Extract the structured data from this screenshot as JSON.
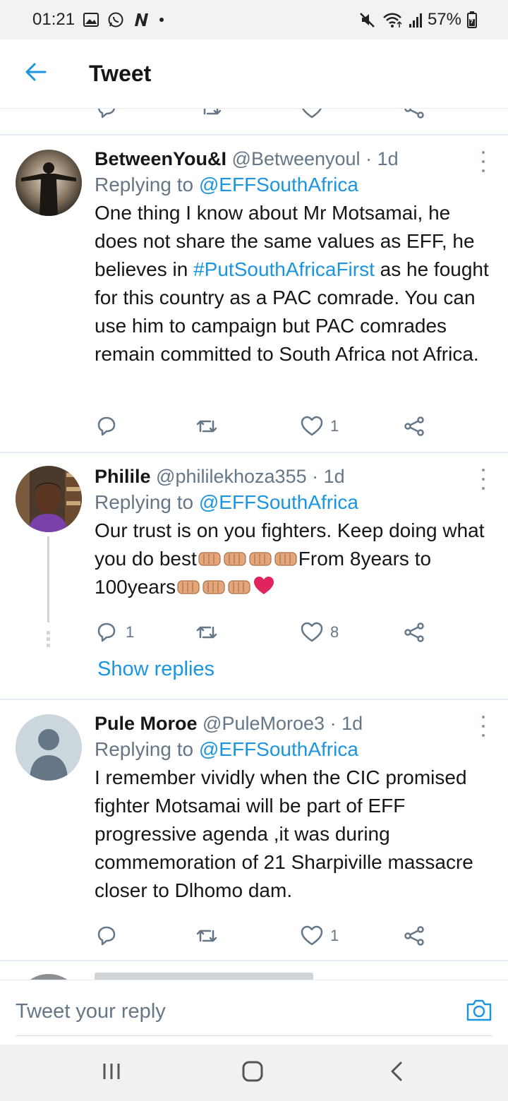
{
  "status_bar": {
    "time": "01:21",
    "battery": "57%",
    "icons_left": [
      "gallery-icon",
      "whatsapp-icon",
      "n-app-icon",
      "dot-icon"
    ],
    "icons_right": [
      "mute-icon",
      "wifi-icon",
      "signal-icon",
      "battery-icon"
    ]
  },
  "header": {
    "title": "Tweet",
    "back_icon": "arrow-left-icon"
  },
  "colors": {
    "accent": "#1b95e0",
    "secondary_text": "#657786",
    "heart": "#e0245e"
  },
  "tweets": [
    {
      "name": "BetweenYou&I",
      "handle": "@Betweenyoul",
      "sep": "·",
      "time": "1d",
      "replying_prefix": "Replying to",
      "replying_to": "@EFFSouthAfrica",
      "text_1": "One thing I know about Mr Motsamai, he does not share the same values as EFF, he believes in",
      "hashtag": "#PutSouthAfricaFirst",
      "text_2": "as he fought for this country as a PAC comrade. You can use him to campaign but PAC comrades remain committed to South Africa not Africa.",
      "reply_count": "",
      "like_count": "1"
    },
    {
      "name": "Philile",
      "handle": "@phililekhoza355",
      "sep": "·",
      "time": "1d",
      "replying_prefix": "Replying to",
      "replying_to": "@EFFSouthAfrica",
      "text_1": "Our trust is on you fighters. Keep doing what you do best",
      "text_2": "From 8years to 100years",
      "emoji": [
        "oncoming-fist",
        "oncoming-fist",
        "oncoming-fist",
        "oncoming-fist",
        "oncoming-fist",
        "oncoming-fist",
        "oncoming-fist",
        "red-heart"
      ],
      "reply_count": "1",
      "like_count": "8",
      "show_replies": "Show replies"
    },
    {
      "name": "Pule Moroe",
      "handle": "@PuleMoroe3",
      "sep": "·",
      "time": "1d",
      "replying_prefix": "Replying to",
      "replying_to": "@EFFSouthAfrica",
      "text": "I remember vividly when the CIC promised fighter Motsamai will be part of EFF progressive agenda ,it was during commemoration of 21 Sharpiville massacre closer to  Dlhomo dam.",
      "reply_count": "",
      "like_count": "1"
    }
  ],
  "reply_bar": {
    "placeholder": "Tweet your reply",
    "camera_icon": "camera-icon"
  },
  "nav_bar": {
    "icons": [
      "recent-apps-icon",
      "home-icon",
      "back-icon"
    ]
  }
}
